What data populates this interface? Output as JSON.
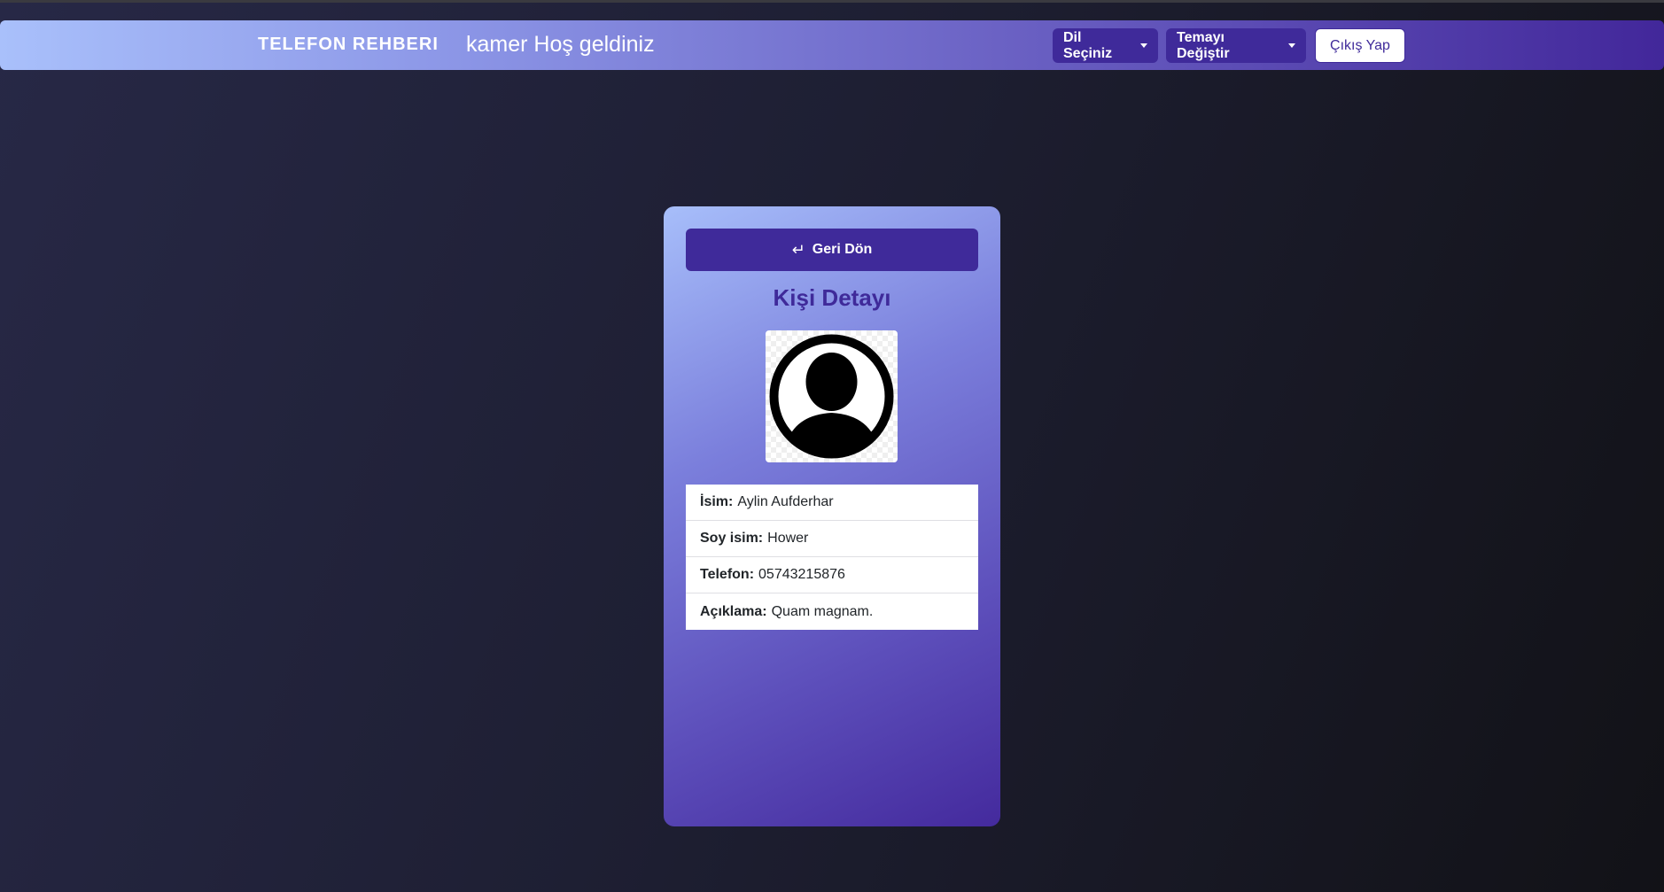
{
  "navbar": {
    "brand": "TELEFON REHBERI",
    "welcome": "kamer Hoş geldiniz",
    "language_dropdown": "Dil Seçiniz",
    "theme_dropdown": "Temayı Değiştir",
    "logout_button": "Çıkış Yap"
  },
  "card": {
    "back_button": "Geri Dön",
    "back_icon": "return-arrow-icon",
    "title": "Kişi Detayı",
    "avatar_icon": "user-avatar-icon",
    "fields": [
      {
        "label": "İsim:",
        "value": "Aylin Aufderhar"
      },
      {
        "label": "Soy isim:",
        "value": "Hower"
      },
      {
        "label": "Telefon:",
        "value": "05743215876"
      },
      {
        "label": "Açıklama:",
        "value": "Quam magnam."
      }
    ]
  },
  "colors": {
    "accent": "#3f2a9a",
    "background_dark": "#1e1f33",
    "gradient_light": "#a9c0fb"
  }
}
